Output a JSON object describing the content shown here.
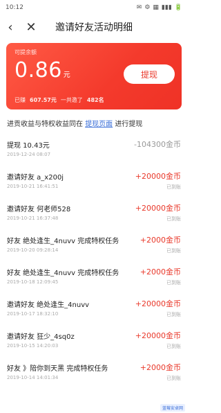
{
  "status_bar": {
    "time": "10:12",
    "icons": [
      "✉",
      "⚙",
      "▦",
      "▮▮▮",
      "🔋"
    ]
  },
  "header": {
    "back_icon": "back-icon",
    "close_icon": "close-icon",
    "title": "邀请好友活动明细"
  },
  "card": {
    "label": "可提余额",
    "amount": "0.86",
    "unit": "元",
    "withdraw_label": "提现",
    "stats_prefix": "已赚",
    "stats_earned": "607.57元",
    "stats_mid": "一共邀了",
    "stats_invited": "482名"
  },
  "notice": {
    "before": "进贡收益与特权收益同在",
    "link": "提现页面",
    "after": "进行提现"
  },
  "records": [
    {
      "title": "提现 10.43元",
      "date": "2019-12-24 08:07",
      "amount": "-104300金币",
      "status": "",
      "negative": true
    },
    {
      "title": "邀请好友 a_x200j",
      "date": "2019-10-21 16:41:51",
      "amount": "+20000金币",
      "status": "已到账",
      "negative": false
    },
    {
      "title": "邀请好友 何老师528",
      "date": "2019-10-21 16:37:48",
      "amount": "+20000金币",
      "status": "已到账",
      "negative": false
    },
    {
      "title": "好友 绝处逢生_4nuvv 完成特权任务",
      "date": "2019-10-20 09:28:14",
      "amount": "+2000金币",
      "status": "已到账",
      "negative": false
    },
    {
      "title": "好友 绝处逢生_4nuvv 完成特权任务",
      "date": "2019-10-18 12:09:45",
      "amount": "+2000金币",
      "status": "已到账",
      "negative": false
    },
    {
      "title": "邀请好友 绝处逢生_4nuvv",
      "date": "2019-10-17 18:32:10",
      "amount": "+20000金币",
      "status": "已到账",
      "negative": false
    },
    {
      "title": "邀请好友 狂少_4sq0z",
      "date": "2019-10-15 14:20:03",
      "amount": "+20000金币",
      "status": "已到账",
      "negative": false
    },
    {
      "title": "好友 》陪你到天黑 完成特权任务",
      "date": "2019-10-14 14:01:34",
      "amount": "+2000金币",
      "status": "已到账",
      "negative": false
    }
  ],
  "watermark": "蓝莓安卓网"
}
